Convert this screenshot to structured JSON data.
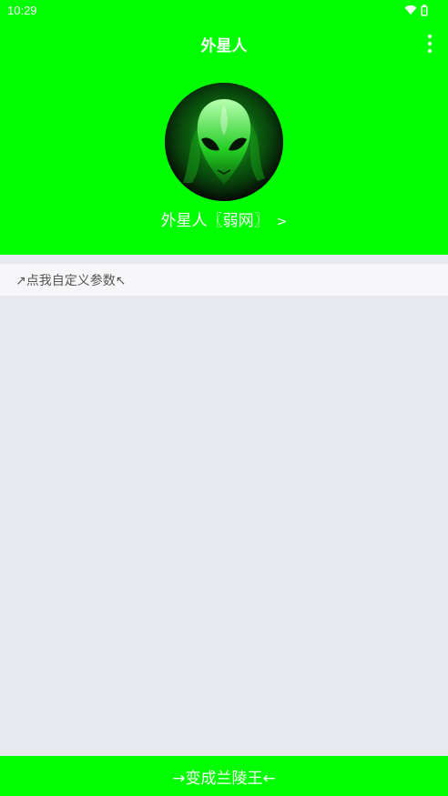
{
  "status_bar": {
    "time": "10:29",
    "icons": [
      "wifi-icon",
      "battery-icon"
    ]
  },
  "header": {
    "title": "外星人",
    "menu_icon": "more-vert-icon"
  },
  "profile": {
    "avatar_icon": "alien-head-icon",
    "name": "外星人〖弱网〗",
    "arrow": ">"
  },
  "param_row": {
    "label": "↗点我自定义参数↖"
  },
  "bottom_button": {
    "label": "→变成兰陵王←"
  },
  "colors": {
    "accent": "#00ff00",
    "background": "#e8e9ef",
    "row_background": "#f7f7f9"
  }
}
